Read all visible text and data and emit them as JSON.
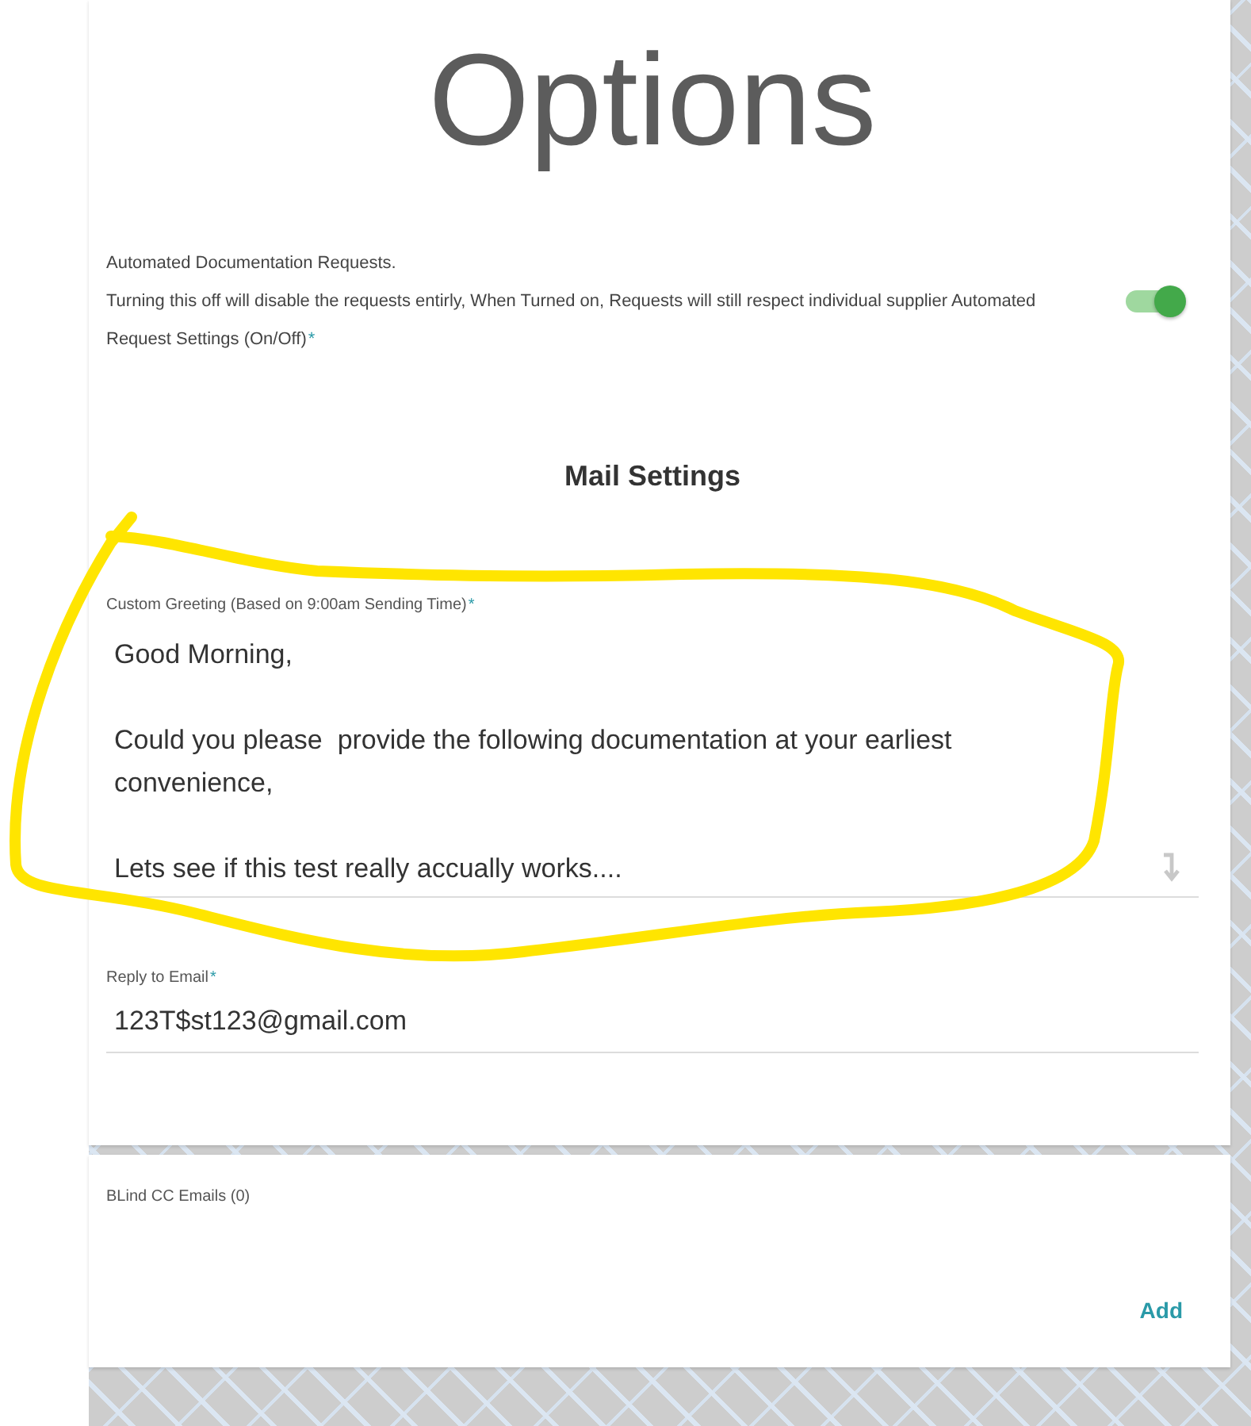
{
  "title": "Options",
  "automation": {
    "heading": "Automated Documentation Requests.",
    "description": "Turning this off will disable the requests entirly, When Turned on, Requests will still respect individual supplier Automated Request Settings (On/Off)",
    "required_mark": "*",
    "on": true
  },
  "mail_settings": {
    "heading": "Mail Settings",
    "fields": [
      {
        "kind": "textarea",
        "label": "Custom Greeting (Based on 9:00am Sending Time)",
        "required_mark": "*",
        "value": "Good Morning,\n\nCould you please  provide the following documentation at your earliest convenience,\n\nLets see if this test really accually works...."
      },
      {
        "kind": "input",
        "label": "Reply to Email",
        "required_mark": "*",
        "value": "123T$st123@gmail.com"
      }
    ]
  },
  "bcc": {
    "label": "BLind CC Emails (0)",
    "button": "Add"
  }
}
